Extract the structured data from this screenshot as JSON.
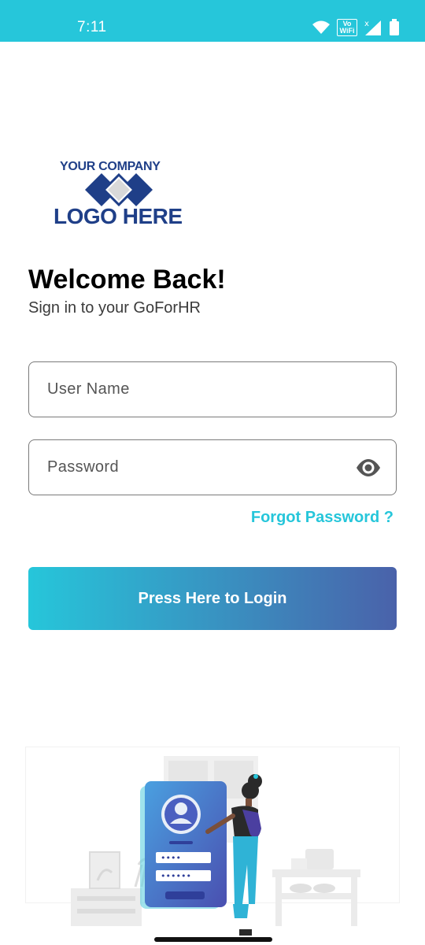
{
  "status_bar": {
    "time": "7:11",
    "vowifi_top": "Vo",
    "vowifi_bottom": "WiFi",
    "background": "#26c6da"
  },
  "logo": {
    "line1": "YOUR COMPANY",
    "line2": "LOGO HERE",
    "color": "#1f3f88"
  },
  "header": {
    "title": "Welcome Back!",
    "subtitle": "Sign in to your GoForHR"
  },
  "form": {
    "username_placeholder": "User Name",
    "username_value": "",
    "password_placeholder": "Password",
    "password_value": "",
    "forgot_label": "Forgot Password ?",
    "login_label": "Press Here to Login"
  },
  "illustration": {
    "username_mask": "••••",
    "password_mask": "••••••"
  },
  "colors": {
    "accent": "#26c6da",
    "gradient_end": "#4a62aa"
  }
}
